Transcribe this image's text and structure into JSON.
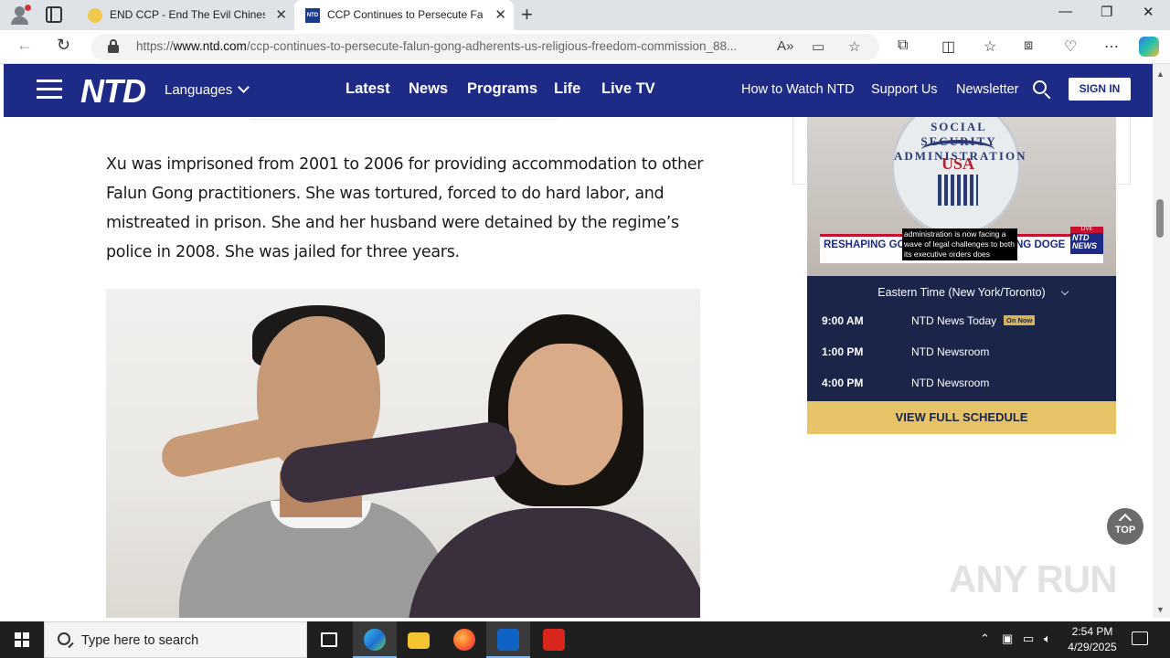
{
  "browser": {
    "tabs": [
      {
        "title": "END CCP - End The Evil Chinese",
        "active": false
      },
      {
        "title": "CCP Continues to Persecute Falu",
        "active": true
      }
    ],
    "url_prefix": "https://",
    "url_host": "www.ntd.com",
    "url_path": "/ccp-continues-to-persecute-falun-gong-adherents-us-religious-freedom-commission_88..."
  },
  "site": {
    "logo": "NTD",
    "languages_label": "Languages",
    "main_nav": [
      "Latest",
      "News",
      "Programs",
      "Life",
      "Live TV"
    ],
    "sub_nav": [
      "How to Watch NTD",
      "Support Us",
      "Newsletter"
    ],
    "signin_label": "SIGN IN"
  },
  "article": {
    "paragraph": "Xu was imprisoned from 2001 to 2006 for providing accommodation to other Falun Gong practitioners. She was tortured, forced to do hard labor, and mistreated in prison. She and her husband were detained by the regime’s police in 2008. She was jailed for three years."
  },
  "sidebar": {
    "player": {
      "seal_text": "SOCIAL SECURITY ADMINISTRATION",
      "seal_usa": "USA",
      "lower_third_left": "RESHAPING GOV",
      "lower_third_right": "NG DOGE",
      "caption": "administration is now facing a wave of legal challenges to both its executive orders does",
      "live_badge": "LIVE",
      "badge_logo": "NTD NEWS"
    },
    "timezone": "Eastern Time (New York/Toronto)",
    "schedule": [
      {
        "time": "9:00 AM",
        "show": "NTD News Today",
        "on_now": "On Now"
      },
      {
        "time": "1:00 PM",
        "show": "NTD Newsroom"
      },
      {
        "time": "4:00 PM",
        "show": "NTD Newsroom"
      }
    ],
    "view_schedule_label": "VIEW FULL SCHEDULE"
  },
  "top_button_label": "TOP",
  "watermark": "ANY RUN",
  "taskbar": {
    "search_placeholder": "Type here to search",
    "time": "2:54 PM",
    "date": "4/29/2025"
  }
}
